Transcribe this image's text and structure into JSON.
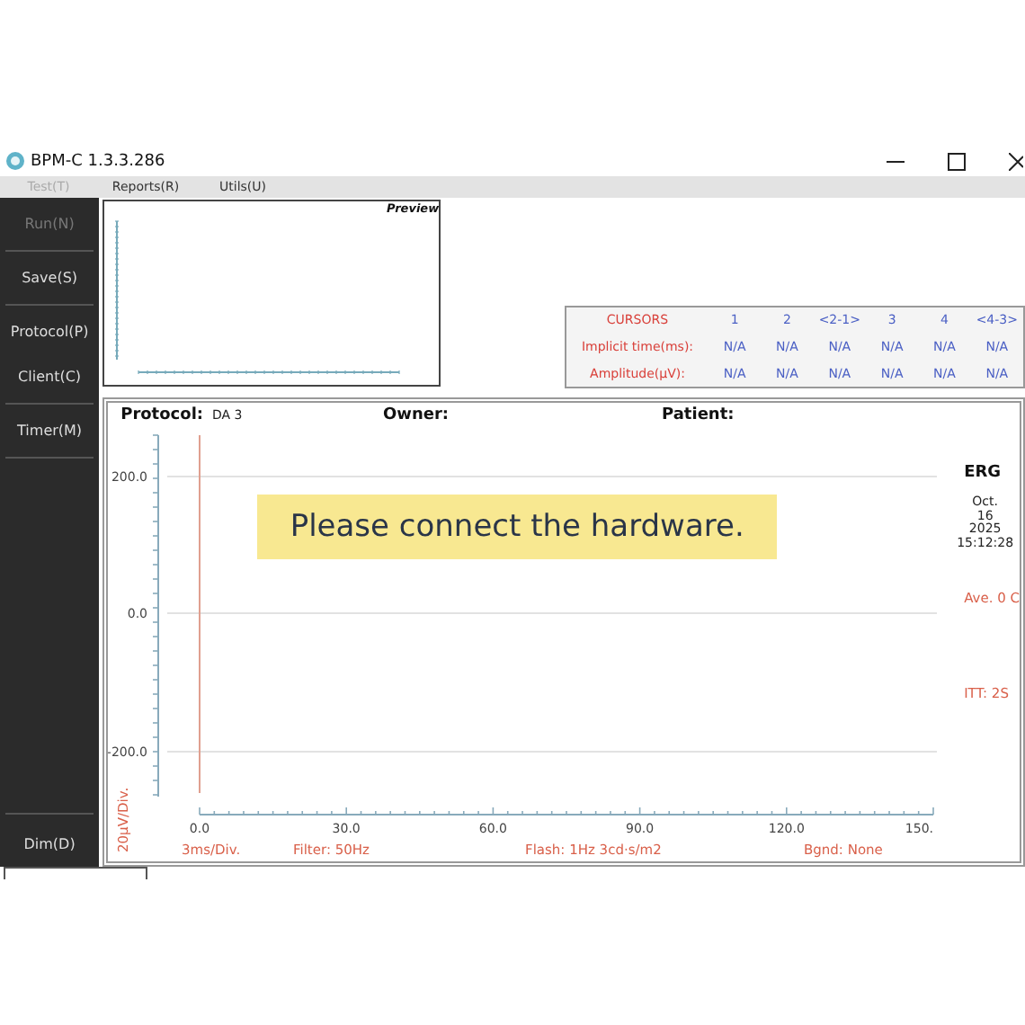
{
  "window": {
    "title": "BPM-C 1.3.3.286"
  },
  "menu": [
    {
      "label": "Test(T)",
      "disabled": true
    },
    {
      "label": "Reports(R)",
      "disabled": false
    },
    {
      "label": "Utils(U)",
      "disabled": false
    }
  ],
  "sidebar": {
    "groups": [
      {
        "items": [
          {
            "label": "Run(N)",
            "disabled": true
          }
        ]
      },
      {
        "items": [
          {
            "label": "Save(S)",
            "disabled": false
          }
        ]
      },
      {
        "items": [
          {
            "label": "Protocol(P)",
            "disabled": false
          },
          {
            "label": "Client(C)",
            "disabled": false
          }
        ]
      },
      {
        "items": [
          {
            "label": "Timer(M)",
            "disabled": false
          }
        ]
      }
    ],
    "bottom_items": [
      {
        "label": "Dim(D)",
        "disabled": false
      }
    ]
  },
  "preview": {
    "title": "Preview"
  },
  "cursors": {
    "columns": [
      "CURSORS",
      "1",
      "2",
      "<2-1>",
      "3",
      "4",
      "<4-3>"
    ],
    "rows": [
      {
        "label": "Implicit time(ms):",
        "values": [
          "N/A",
          "N/A",
          "N/A",
          "N/A",
          "N/A",
          "N/A"
        ]
      },
      {
        "label": "Amplitude(μV):",
        "values": [
          "N/A",
          "N/A",
          "N/A",
          "N/A",
          "N/A",
          "N/A"
        ]
      }
    ]
  },
  "recording": {
    "protocol_label": "Protocol:",
    "protocol": "DA 3",
    "owner_label": "Owner:",
    "patient_label": "Patient:",
    "banner": "Please connect the hardware.",
    "plot": {
      "y_ticks": [
        "200.0",
        "0.0",
        "-200.0"
      ],
      "x_ticks": [
        "0.0",
        "30.0",
        "60.0",
        "90.0",
        "120.0",
        "150."
      ],
      "y_label": "20μV/Div.",
      "footer": [
        "3ms/Div.",
        "Filter: 50Hz",
        "Flash: 1Hz 3cd·s/m2",
        "Bgnd: None"
      ]
    },
    "info": {
      "test": "ERG",
      "date": [
        "Oct.",
        "16",
        "2025",
        "15:12:28"
      ],
      "average": "Ave. 0 C",
      "itt": "ITT: 2S"
    }
  }
}
